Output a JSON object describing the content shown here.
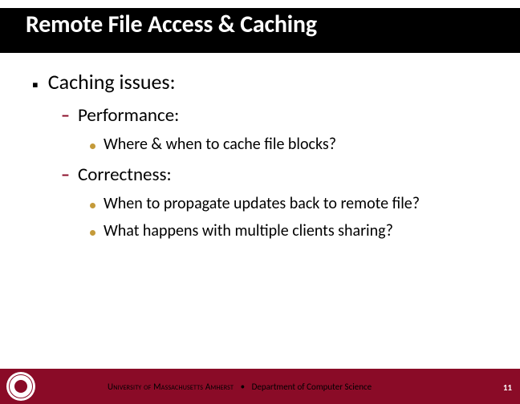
{
  "title": "Remote File Access & Caching",
  "body": {
    "lvl1": "Caching issues:",
    "sections": [
      {
        "heading": "Performance:",
        "bullets": [
          "Where & when to cache file blocks?"
        ]
      },
      {
        "heading": "Correctness:",
        "bullets": [
          "When to propagate updates back to remote file?",
          "What happens with multiple clients sharing?"
        ]
      }
    ]
  },
  "footer": {
    "university": "University of Massachusetts Amherst",
    "separator": "•",
    "department": "Department of Computer Science",
    "page": "11"
  }
}
